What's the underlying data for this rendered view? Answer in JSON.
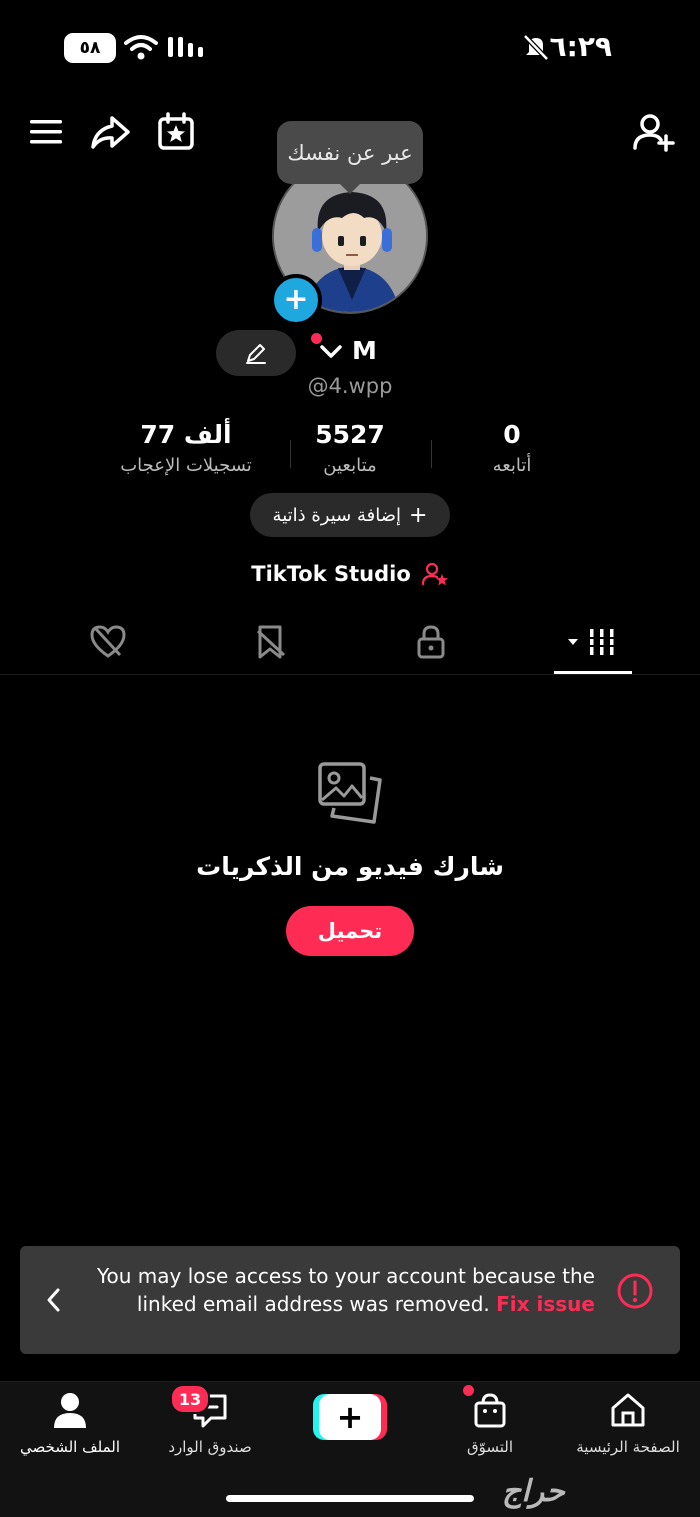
{
  "status_bar": {
    "time": "٦:٢٩",
    "battery": "٥٨"
  },
  "tooltip": "عبر عن نفسك",
  "profile": {
    "name": "M",
    "username": "@4.wpp",
    "stats": [
      {
        "value": "0",
        "label": "أتابعه"
      },
      {
        "value": "5527",
        "label": "متابعين"
      },
      {
        "value": "77 ألف",
        "label": "تسجيلات الإعجاب"
      }
    ],
    "add_bio_label": "إضافة سيرة ذاتية",
    "studio_label": "TikTok Studio"
  },
  "tabs": [
    {
      "icon": "videos-grid-icon",
      "active": true
    },
    {
      "icon": "lock-icon",
      "active": false
    },
    {
      "icon": "bookmark-icon",
      "active": false
    },
    {
      "icon": "liked-heart-icon",
      "active": false
    }
  ],
  "empty_state": {
    "title": "شارك فيديو من الذكريات",
    "button": "تحميل"
  },
  "banner": {
    "message": "You may lose access to your account because the linked email address was removed.",
    "fix_label": "Fix issue"
  },
  "bottom_nav": {
    "home": "الصفحة الرئيسية",
    "shop": "التسوّق",
    "inbox": "صندوق الوارد",
    "inbox_badge": "13",
    "profile": "الملف الشخصي"
  },
  "watermark": "حراج",
  "colors": {
    "accent": "#fe2c55",
    "badge_blue": "#1fa7e0",
    "banner_bg": "#3a3a3a"
  }
}
